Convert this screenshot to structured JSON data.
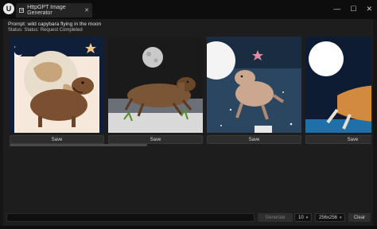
{
  "window": {
    "tab_title": "HttpGPT Image Generator",
    "tab_close": "✕",
    "minimize": "—",
    "maximize": "☐",
    "close": "✕",
    "logo": "U"
  },
  "header": {
    "prompt": "Prompt: wild capybara flying in the moon",
    "status": "Status: Status: Request Completed"
  },
  "gallery": {
    "save_label": "Save",
    "items": [
      {
        "alt": "Illustrated capybara with moon and star"
      },
      {
        "alt": "Photorealistic capybara running under full moon"
      },
      {
        "alt": "Capybara floating in night sky with moon"
      },
      {
        "alt": "Orange capybara under white moon"
      }
    ]
  },
  "controls": {
    "prompt_placeholder": "",
    "generate_label": "Generate",
    "count_value": "10",
    "size_value": "256x256",
    "clear_label": "Clear",
    "chevron": "▾"
  }
}
